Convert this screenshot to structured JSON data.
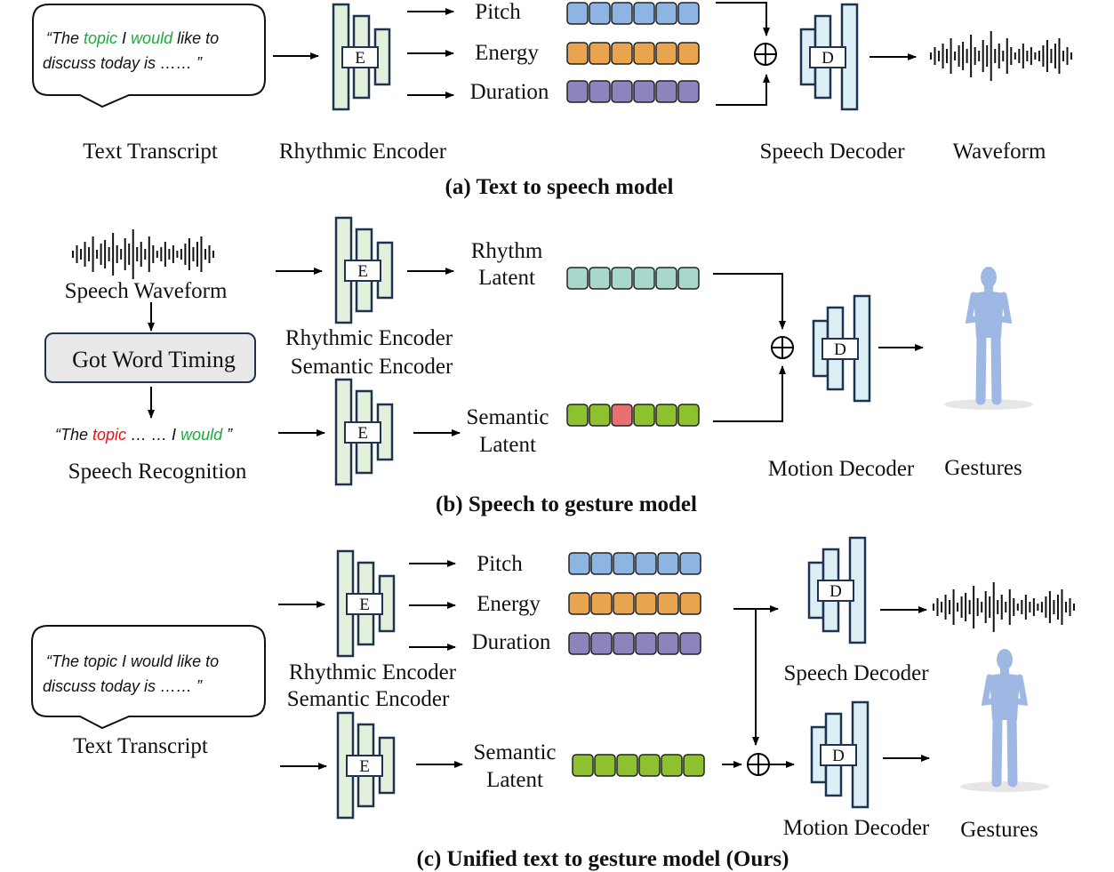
{
  "colors": {
    "encoder_fill": "#e3f1dc",
    "decoder_fill": "#dceff5",
    "stroke": "#1f3350",
    "pitch": "#8db4e2",
    "energy": "#e8a44f",
    "duration": "#8c84bd",
    "rhythm": "#a8d8cc",
    "semantic": "#8dc22e",
    "semantic_masked": "#e87070",
    "highlight_green": "#1aaa3c",
    "highlight_red": "#ee1111",
    "body": "#9fb8e3"
  },
  "panel_a": {
    "bubble": {
      "l1": [
        {
          "t": "“The ",
          "c": "n"
        },
        {
          "t": "topic",
          "c": "g"
        },
        {
          "t": " I ",
          "c": "n"
        },
        {
          "t": "would",
          "c": "g"
        },
        {
          "t": " like to",
          "c": "n"
        }
      ],
      "l2": "discuss today is …… ”"
    },
    "encoder_letter": "E",
    "decoder_letter": "D",
    "pitch": "Pitch",
    "energy": "Energy",
    "duration": "Duration",
    "text_transcript": "Text Transcript",
    "rhythmic_encoder": "Rhythmic Encoder",
    "speech_decoder": "Speech Decoder",
    "waveform": "Waveform",
    "caption": "(a) Text to speech model"
  },
  "panel_b": {
    "speech_waveform": "Speech Waveform",
    "got_word_timing": "Got Word Timing",
    "recognized": [
      {
        "t": "“The ",
        "c": "n"
      },
      {
        "t": "topic",
        "c": "r"
      },
      {
        "t": " … … I ",
        "c": "n"
      },
      {
        "t": "would",
        "c": "g"
      },
      {
        "t": " ”",
        "c": "n"
      }
    ],
    "speech_recognition": "Speech Recognition",
    "rhythmic_encoder": "Rhythmic Encoder",
    "semantic_encoder": "Semantic Encoder",
    "rhythm_latent": [
      "Rhythm",
      "Latent"
    ],
    "semantic_latent": [
      "Semantic",
      "Latent"
    ],
    "motion_decoder": "Motion Decoder",
    "gestures": "Gestures",
    "caption": "(b) Speech to gesture model"
  },
  "panel_c": {
    "bubble": {
      "l1": "“The topic I would like to",
      "l2": "discuss today is …… ”"
    },
    "text_transcript": "Text Transcript",
    "pitch": "Pitch",
    "energy": "Energy",
    "duration": "Duration",
    "rhythmic_encoder": "Rhythmic Encoder",
    "semantic_encoder": "Semantic Encoder",
    "semantic_latent": [
      "Semantic",
      "Latent"
    ],
    "speech_decoder": "Speech Decoder",
    "motion_decoder": "Motion Decoder",
    "gestures": "Gestures",
    "caption": "(c) Unified text to gesture model (Ours)"
  }
}
